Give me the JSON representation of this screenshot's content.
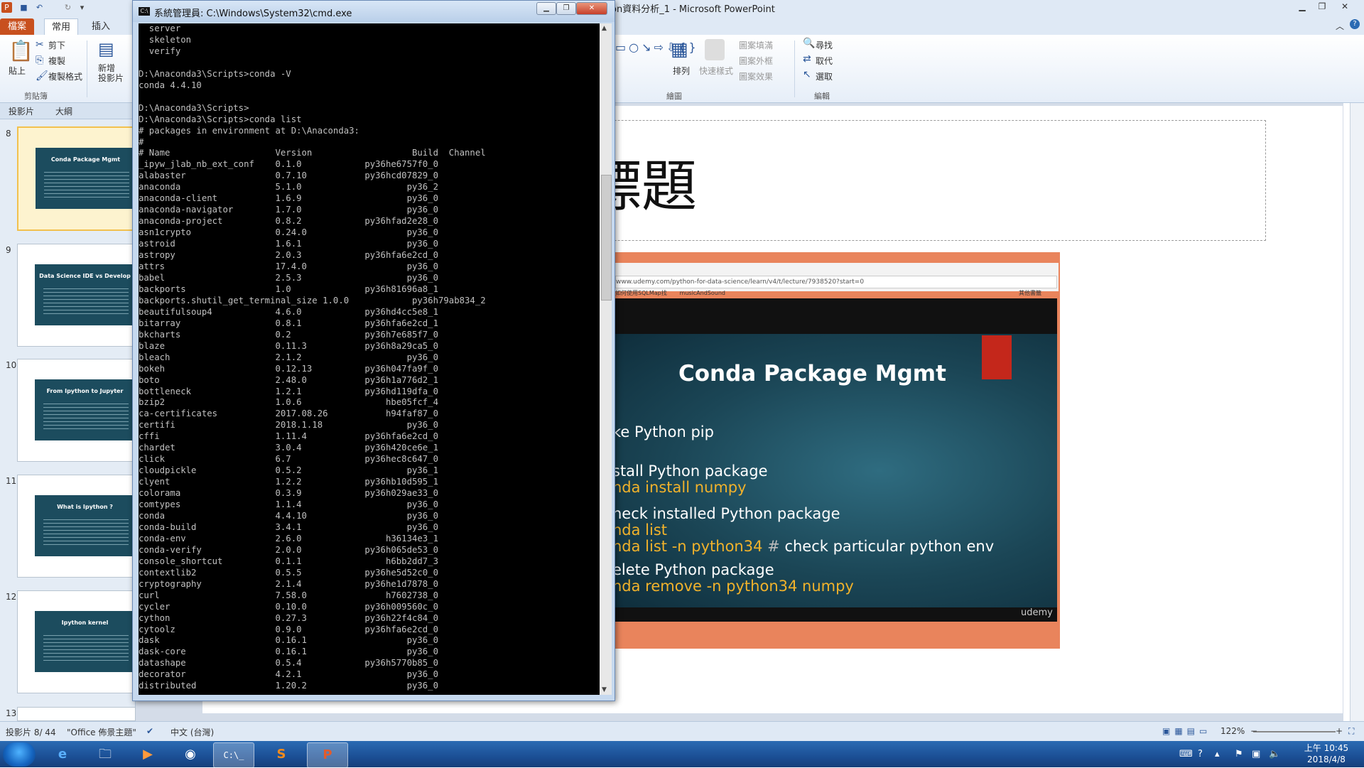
{
  "ppt": {
    "title": "on資料分析_1 - Microsoft PowerPoint",
    "tabs": {
      "file": "檔案",
      "home": "常用",
      "insert": "插入"
    },
    "ribbon": {
      "paste": "貼上",
      "cut": "剪下",
      "copy": "複製",
      "format_painter": "複製格式",
      "clipboard_group": "剪貼簿",
      "new_slide": "新增\n投影片",
      "arrange": "排列",
      "quick_styles": "快速樣式",
      "shape_fill": "圖案填滿",
      "shape_outline": "圖案外框",
      "shape_effects": "圖案效果",
      "drawing_group": "繪圖",
      "find": "尋找",
      "replace": "取代",
      "select": "選取",
      "editing_group": "編輯"
    },
    "panel_tabs": {
      "slides": "投影片",
      "outline": "大綱"
    },
    "thumbnails": [
      {
        "num": "8",
        "title": "Conda Package Mgmt",
        "selected": true
      },
      {
        "num": "9",
        "title": "Data Science IDE vs Develop"
      },
      {
        "num": "10",
        "title": "From Ipython to Jupyter"
      },
      {
        "num": "11",
        "title": "What is Ipython ?"
      },
      {
        "num": "12",
        "title": "Ipython kernel"
      },
      {
        "num": "13",
        "title": ""
      }
    ],
    "slide_title": "標題",
    "embedded": {
      "url": "www.udemy.com/python-for-data-science/learn/v4/t/lecture/7938520?start=0",
      "bookmark1": "如何使用SQLMap找",
      "bookmark2": "musicAndSound",
      "bookmark3": "其他書籤",
      "heading": "Conda Package Mgmt",
      "lines": {
        "l1": "ke Python pip",
        "l2": "stall Python package",
        "l3": "nda install numpy",
        "l4": "heck installed Python package",
        "l5": "nda list",
        "l6a": "nda list -n python34",
        "l6b": "#",
        "l6c": "check particular python env",
        "l7": "elete Python package",
        "l8": "nda remove -n python34 numpy"
      },
      "brand": "udemy"
    },
    "status": {
      "slide_count": "投影片 8/ 44",
      "theme": "\"Office 佈景主題\"",
      "language": "中文 (台灣)",
      "zoom": "122%"
    }
  },
  "cmd": {
    "title": "系統管理員: C:\\Windows\\System32\\cmd.exe",
    "icon_text": "C:\\",
    "console": "  server\n  skeleton\n  verify\n\nD:\\Anaconda3\\Scripts>conda -V\nconda 4.4.10\n\nD:\\Anaconda3\\Scripts>\nD:\\Anaconda3\\Scripts>conda list\n# packages in environment at D:\\Anaconda3:\n#\n# Name                    Version                   Build  Channel\n_ipyw_jlab_nb_ext_conf    0.1.0            py36he6757f0_0\nalabaster                 0.7.10           py36hcd07829_0\nanaconda                  5.1.0                    py36_2\nanaconda-client           1.6.9                    py36_0\nanaconda-navigator        1.7.0                    py36_0\nanaconda-project          0.8.2            py36hfad2e28_0\nasn1crypto                0.24.0                   py36_0\nastroid                   1.6.1                    py36_0\nastropy                   2.0.3            py36hfa6e2cd_0\nattrs                     17.4.0                   py36_0\nbabel                     2.5.3                    py36_0\nbackports                 1.0              py36h81696a8_1\nbackports.shutil_get_terminal_size 1.0.0            py36h79ab834_2\nbeautifulsoup4            4.6.0            py36hd4cc5e8_1\nbitarray                  0.8.1            py36hfa6e2cd_1\nbkcharts                  0.2              py36h7e685f7_0\nblaze                     0.11.3           py36h8a29ca5_0\nbleach                    2.1.2                    py36_0\nbokeh                     0.12.13          py36h047fa9f_0\nboto                      2.48.0           py36h1a776d2_1\nbottleneck                1.2.1            py36hd119dfa_0\nbzip2                     1.0.6                hbe05fcf_4\nca-certificates           2017.08.26           h94faf87_0\ncertifi                   2018.1.18                py36_0\ncffi                      1.11.4           py36hfa6e2cd_0\nchardet                   3.0.4            py36h420ce6e_1\nclick                     6.7              py36hec8c647_0\ncloudpickle               0.5.2                    py36_1\nclyent                    1.2.2            py36hb10d595_1\ncolorama                  0.3.9            py36h029ae33_0\ncomtypes                  1.1.4                    py36_0\nconda                     4.4.10                   py36_0\nconda-build               3.4.1                    py36_0\nconda-env                 2.6.0                h36134e3_1\nconda-verify              2.0.0            py36h065de53_0\nconsole_shortcut          0.1.1                h6bb2dd7_3\ncontextlib2               0.5.5            py36he5d52c0_0\ncryptography              2.1.4            py36he1d7878_0\ncurl                      7.58.0               h7602738_0\ncycler                    0.10.0           py36h009560c_0\ncython                    0.27.3           py36h22f4c84_0\ncytoolz                   0.9.0            py36hfa6e2cd_0\ndask                      0.16.1                   py36_0\ndask-core                 0.16.1                   py36_0\ndatashape                 0.5.4            py36h5770b85_0\ndecorator                 4.2.1                    py36_0\ndistributed               1.20.2                   py36_0"
  },
  "taskbar": {
    "time": "上午 10:45",
    "date": "2018/4/8"
  }
}
